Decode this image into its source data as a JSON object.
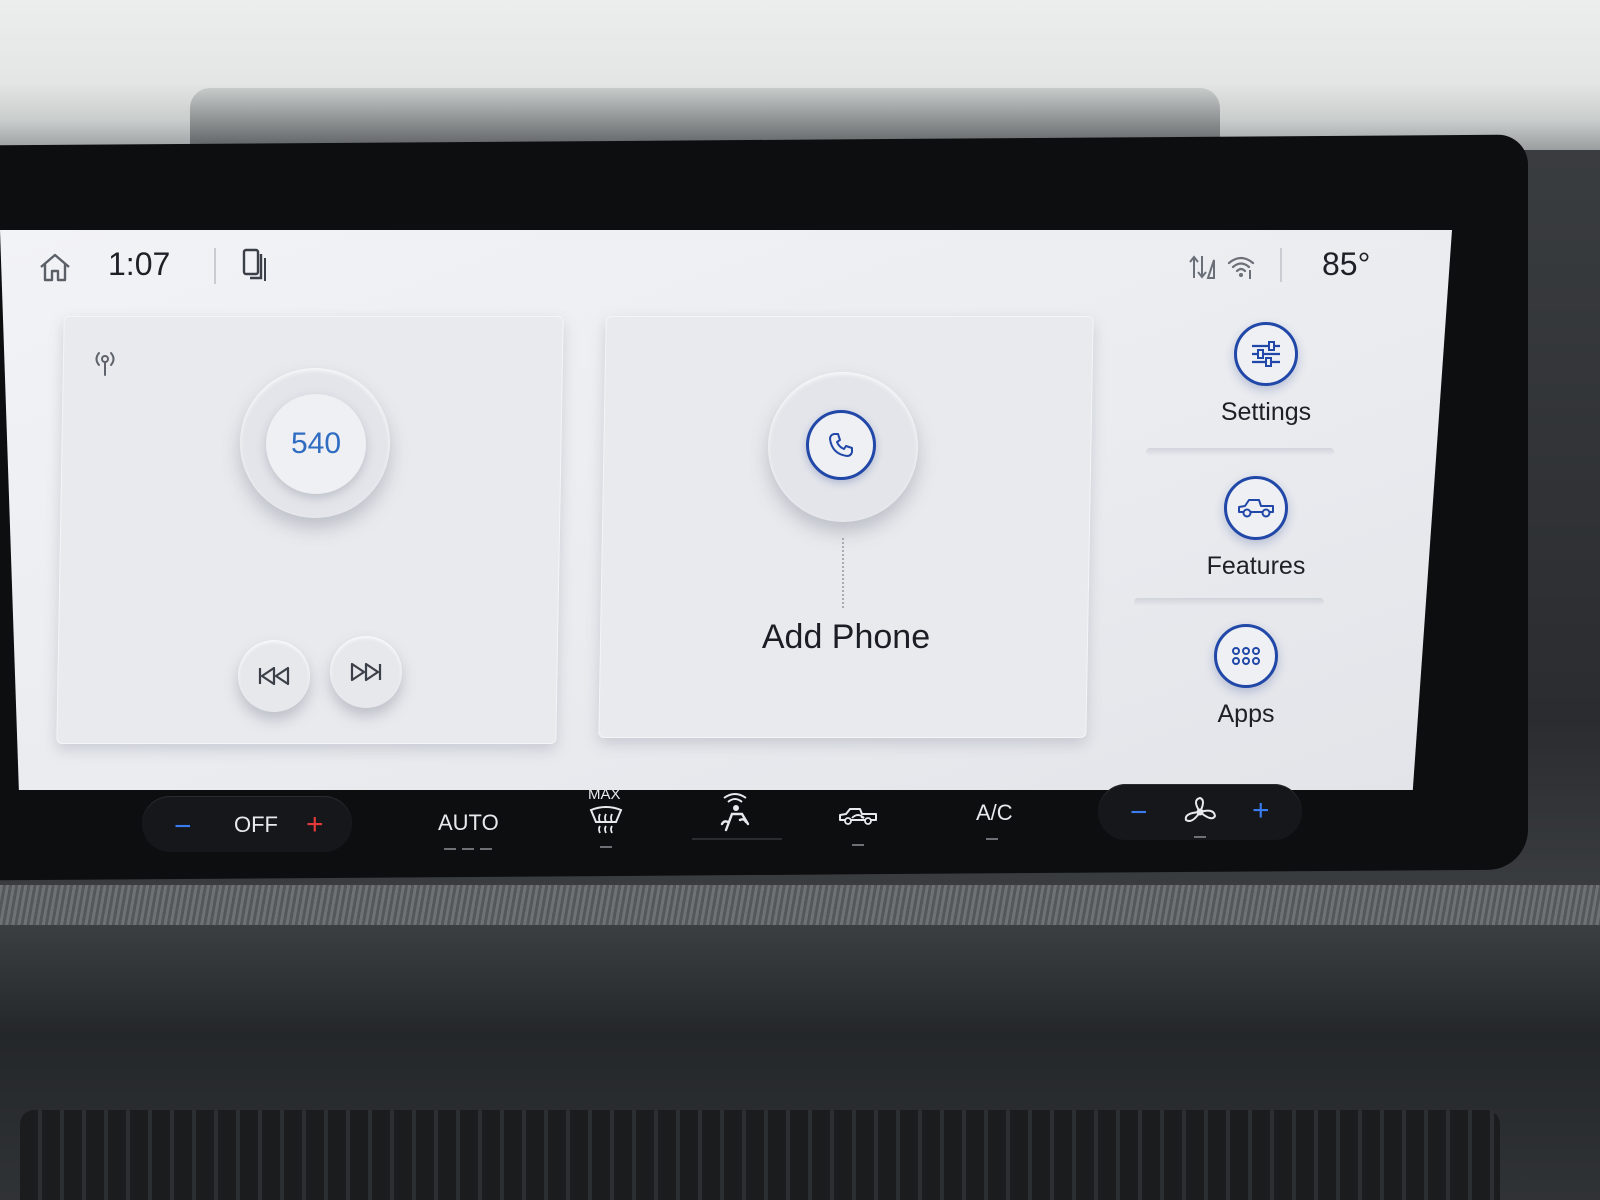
{
  "status_bar": {
    "time": "1:07",
    "outside_temp": "85°",
    "icons": [
      "home-icon",
      "phone-projection-icon",
      "signal-transfer-icon",
      "wifi-icon"
    ]
  },
  "radio": {
    "station": "540",
    "icons": [
      "broadcast-icon",
      "previous-track-icon",
      "next-track-icon"
    ]
  },
  "phone_card": {
    "label": "Add Phone",
    "icon": "phone-icon"
  },
  "rail": {
    "settings": "Settings",
    "features": "Features",
    "apps": "Apps"
  },
  "climate": {
    "left_minus": "−",
    "left_temp": "OFF",
    "left_plus": "+",
    "auto": "AUTO",
    "max_label": "MAX",
    "ac": "A/C",
    "fan_minus": "−",
    "fan_plus": "+",
    "icons": [
      "max-defrost-icon",
      "rear-defrost-seat-icon",
      "recirculation-icon",
      "fan-icon"
    ]
  },
  "colors": {
    "accent_blue": "#2148a8",
    "station_blue": "#2f6cc2",
    "plus_red": "#e23a3a",
    "minus_blue": "#3a7bf0"
  }
}
